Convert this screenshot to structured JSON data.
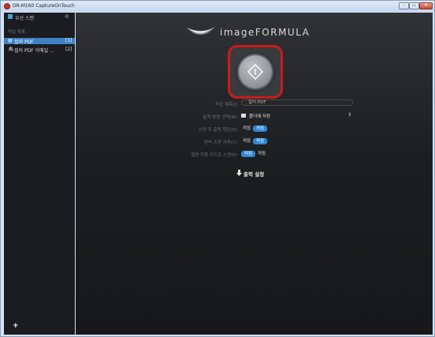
{
  "window": {
    "title": "DR-M160 CaptureOnTouch",
    "min_glyph": "–",
    "max_glyph": "▭",
    "close_glyph": "✕"
  },
  "sidebar": {
    "header_label": "우선 스캔",
    "section_label": "작업 목록",
    "items": [
      {
        "name": "컬러 PDF",
        "count": "[1]",
        "selected": true,
        "icon": "document-icon"
      },
      {
        "name": "컬러 PDF 이메일 ...",
        "count": "[2]",
        "selected": false,
        "icon": "paperclip-icon"
      }
    ],
    "add_label": "+"
  },
  "main": {
    "brand": "imageFORMULA",
    "form": {
      "job_name_label": "작업 제목(J)",
      "job_name_value": "컬러 PDF",
      "output_method_label": "출력 방법 선택(W)",
      "output_method_value": "폴더에 저장",
      "confirm_scan_label": "스캔 후 출력 확인(D)",
      "continuous_scan_label": "연속 스캔 사용(C)",
      "auto_start_label": "향연 자동 모드로 스캔(E)",
      "on_label": "켜짐",
      "off_label": "꺼짐"
    },
    "output_settings_label": "출력 설정"
  },
  "colors": {
    "accent": "#2f86d6",
    "selection": "#3d82c4",
    "highlight_border": "#cc1a1a"
  }
}
